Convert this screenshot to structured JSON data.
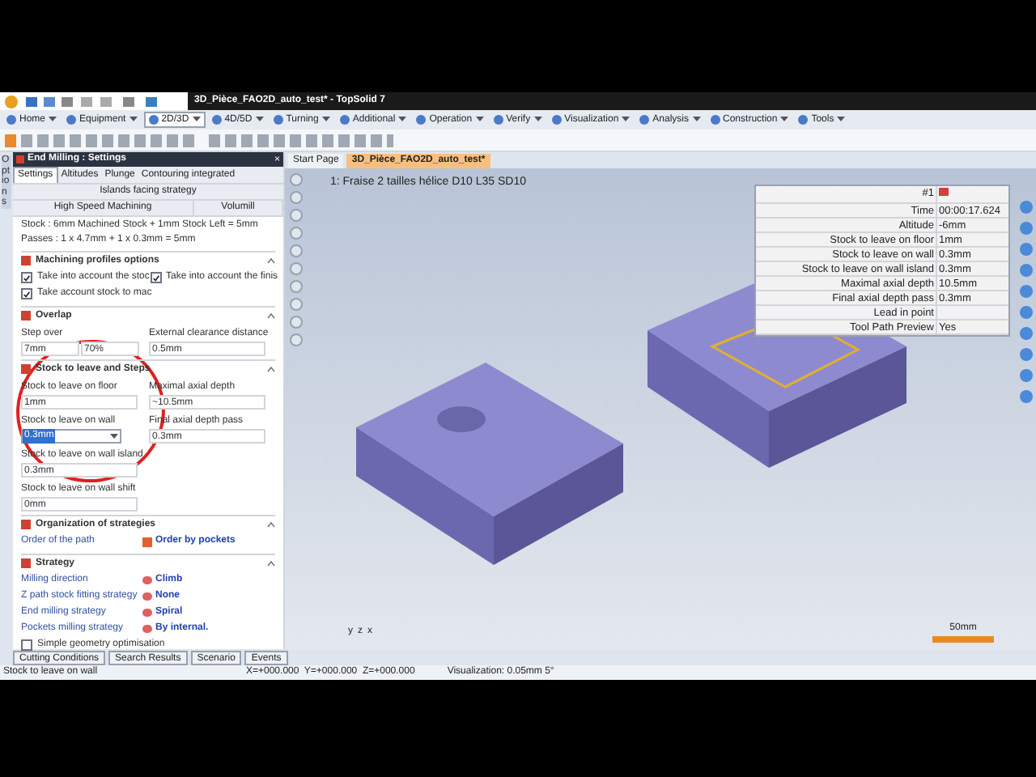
{
  "window": {
    "title": "3D_Pièce_FAO2D_auto_test* - TopSolid 7"
  },
  "ribbon_tabs": [
    {
      "label": "Home",
      "selected": false
    },
    {
      "label": "Equipment",
      "selected": false
    },
    {
      "label": "2D/3D",
      "selected": true
    },
    {
      "label": "4D/5D",
      "selected": false
    },
    {
      "label": "Turning",
      "selected": false
    },
    {
      "label": "Additional",
      "selected": false
    },
    {
      "label": "Operation",
      "selected": false
    },
    {
      "label": "Verify",
      "selected": false
    },
    {
      "label": "Visualization",
      "selected": false
    },
    {
      "label": "Analysis",
      "selected": false
    },
    {
      "label": "Construction",
      "selected": false
    },
    {
      "label": "Tools",
      "selected": false
    }
  ],
  "side_tab": "Options",
  "panel": {
    "title": "End Milling : Settings",
    "close": "×",
    "tabs": [
      {
        "label": "Settings",
        "selected": true
      },
      {
        "label": "Altitudes",
        "selected": false
      },
      {
        "label": "Plunge",
        "selected": false
      },
      {
        "label": "Contouring integrated",
        "selected": false
      }
    ],
    "subtab": "Islands facing strategy",
    "modes": [
      "High Speed Machining",
      "Volumill"
    ],
    "stock_line": "Stock : 6mm Machined Stock + 1mm Stock Left = 5mm",
    "passes_line": "Passes : 1 x 4.7mm + 1 x 0.3mm = 5mm",
    "machining_profiles": {
      "title": "Machining profiles options",
      "checkboxes": [
        {
          "label": "Take into account the stoc",
          "checked": true
        },
        {
          "label": "Take into account the finis",
          "checked": true
        },
        {
          "label": "Take account stock to mac",
          "checked": true
        }
      ]
    },
    "overlap": {
      "title": "Overlap",
      "step_over_label": "Step over",
      "step_over": "7mm",
      "step_over_pct": "70%",
      "clearance_label": "External clearance distance",
      "clearance": "0.5mm"
    },
    "stock": {
      "title": "Stock to leave and Steps",
      "left": [
        {
          "label": "Stock to leave on floor",
          "value": "1mm",
          "kind": "text"
        },
        {
          "label": "Stock to leave on wall",
          "value": "0.3mm",
          "kind": "select"
        },
        {
          "label": "Stock to leave on wall island",
          "value": "0.3mm",
          "kind": "text"
        },
        {
          "label": "Stock to leave on wall shift",
          "value": "0mm",
          "kind": "text"
        }
      ],
      "right": [
        {
          "label": "Maximal axial depth",
          "value": "~10.5mm"
        },
        {
          "label": "Final axial depth pass",
          "value": "0.3mm"
        }
      ]
    },
    "organization": {
      "title": "Organization of strategies",
      "rows": [
        {
          "label": "Order of the path",
          "value": "Order by pockets"
        }
      ]
    },
    "strategy": {
      "title": "Strategy",
      "rows": [
        {
          "label": "Milling direction",
          "value": "Climb"
        },
        {
          "label": "Z path stock fitting strategy",
          "value": "None"
        },
        {
          "label": "End milling strategy",
          "value": "Spiral"
        },
        {
          "label": "Pockets milling strategy",
          "value": "By internal."
        }
      ],
      "checkbox": {
        "label": "Simple geometry optimisation",
        "checked": false
      }
    }
  },
  "doc_tabs": [
    {
      "label": "Start Page",
      "selected": false
    },
    {
      "label": "3D_Pièce_FAO2D_auto_test*",
      "selected": true
    }
  ],
  "viewport": {
    "operation": "1: Fraise 2 tailles hélice D10 L35 SD10",
    "info_header": "#1",
    "info": [
      {
        "label": "Time",
        "value": "00:00:17.624"
      },
      {
        "label": "Altitude",
        "value": "-6mm"
      },
      {
        "label": "Stock to leave on floor",
        "value": "1mm"
      },
      {
        "label": "Stock to leave on wall",
        "value": "0.3mm"
      },
      {
        "label": "Stock to leave on wall island",
        "value": "0.3mm"
      },
      {
        "label": "Maximal axial depth",
        "value": "10.5mm"
      },
      {
        "label": "Final axial depth pass",
        "value": "0.3mm"
      },
      {
        "label": "Lead in point"
      },
      {
        "label": "Tool Path Preview",
        "value": "Yes"
      }
    ],
    "axes": [
      "y",
      "z",
      "x"
    ],
    "scale": "50mm"
  },
  "bottom_tabs": [
    "Cutting Conditions",
    "Search Results",
    "Scenario",
    "Events"
  ],
  "status": {
    "message": "Stock to leave on wall",
    "coords": "X=+000.000  Y=+000.000  Z=+000.000",
    "visualization": "Visualization: 0.05mm 5°"
  }
}
